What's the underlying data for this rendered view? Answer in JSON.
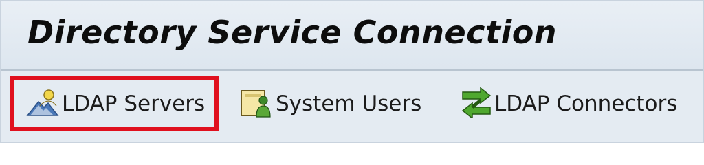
{
  "window": {
    "title": "Directory Service Connection"
  },
  "toolbar": {
    "items": [
      {
        "label": "LDAP Servers",
        "icon": "ldap-server-icon",
        "highlighted": true,
        "highlight_color": "#e0101e"
      },
      {
        "label": "System Users",
        "icon": "system-user-icon",
        "highlighted": false
      },
      {
        "label": "LDAP Connectors",
        "icon": "ldap-connector-icon",
        "highlighted": false
      }
    ]
  }
}
